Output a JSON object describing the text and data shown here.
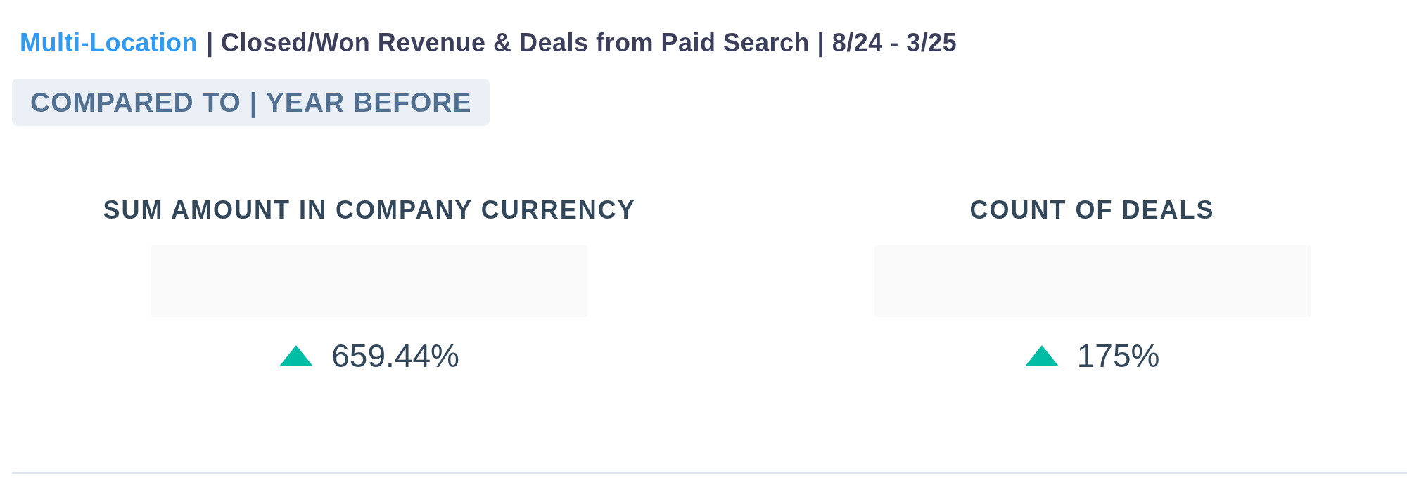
{
  "header": {
    "link": "Multi-Location",
    "title": "| Closed/Won Revenue & Deals from Paid Search | 8/24 - 3/25"
  },
  "comparison_badge": "COMPARED TO | YEAR BEFORE",
  "metrics": [
    {
      "label": "SUM AMOUNT IN COMPANY CURRENCY",
      "increase": true,
      "change": "659.44%"
    },
    {
      "label": "COUNT OF DEALS",
      "increase": true,
      "change": "175%"
    }
  ]
}
